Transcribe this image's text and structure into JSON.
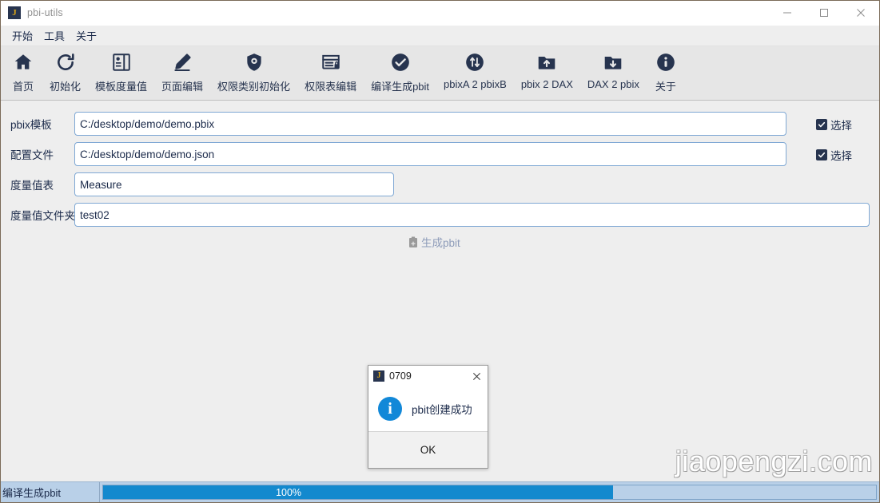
{
  "window": {
    "title": "pbi-utils",
    "icon_letter": "J",
    "controls": {
      "minimize": "minimize-icon",
      "maximize": "maximize-icon",
      "close": "close-icon"
    }
  },
  "menubar": {
    "items": [
      {
        "label": "开始"
      },
      {
        "label": "工具"
      },
      {
        "label": "关于"
      }
    ]
  },
  "toolbar": {
    "items": [
      {
        "label": "首页",
        "icon": "home-icon"
      },
      {
        "label": "初始化",
        "icon": "refresh-icon"
      },
      {
        "label": "模板度量值",
        "icon": "template-panel-icon"
      },
      {
        "label": "页面编辑",
        "icon": "pencil-icon"
      },
      {
        "label": "权限类别初始化",
        "icon": "shield-icon"
      },
      {
        "label": "权限表编辑",
        "icon": "table-lock-icon"
      },
      {
        "label": "编译生成pbit",
        "icon": "check-circle-icon"
      },
      {
        "label": "pbixA 2 pbixB",
        "icon": "transfer-circle-icon"
      },
      {
        "label": "pbix 2 DAX",
        "icon": "folder-up-icon"
      },
      {
        "label": "DAX 2 pbix",
        "icon": "folder-down-icon"
      },
      {
        "label": "关于",
        "icon": "info-circle-icon"
      }
    ]
  },
  "form": {
    "fields": [
      {
        "label": "pbix模板",
        "value": "C:/desktop/demo/demo.pbix",
        "placeholder": "",
        "name": "pbix-template"
      },
      {
        "label": "配置文件",
        "value": "C:/desktop/demo/demo.json",
        "placeholder": "",
        "name": "config-file"
      },
      {
        "label": "度量值表",
        "value": "Measure",
        "placeholder": "",
        "name": "measure-table"
      },
      {
        "label": "度量值文件夹",
        "value": "test02",
        "placeholder": "",
        "name": "measure-folder"
      }
    ],
    "checkboxes": [
      {
        "label": "选择",
        "checked": true,
        "name": "browse-pbix-template"
      },
      {
        "label": "选择",
        "checked": true,
        "name": "browse-config-file"
      }
    ],
    "generate_button": {
      "label": "生成pbit",
      "icon": "clipboard-add-icon",
      "enabled": false
    }
  },
  "dialog": {
    "title": "0709",
    "icon_letter": "J",
    "message": "pbit创建成功",
    "ok_label": "OK",
    "close_icon": "close-icon",
    "info_icon": "info-icon",
    "info_glyph": "i"
  },
  "statusbar": {
    "task": "编译生成pbit",
    "progress_percent": "100%",
    "progress_value": 100
  },
  "watermark": {
    "text": "jiaopengzi.com"
  },
  "colors": {
    "accent_navy": "#27344f",
    "progress_blue": "#1389ce",
    "status_bar": "#b9d0e8",
    "info_blue": "#1288d8",
    "icon_gold": "#d9a518",
    "input_border": "#7fa8d4"
  }
}
